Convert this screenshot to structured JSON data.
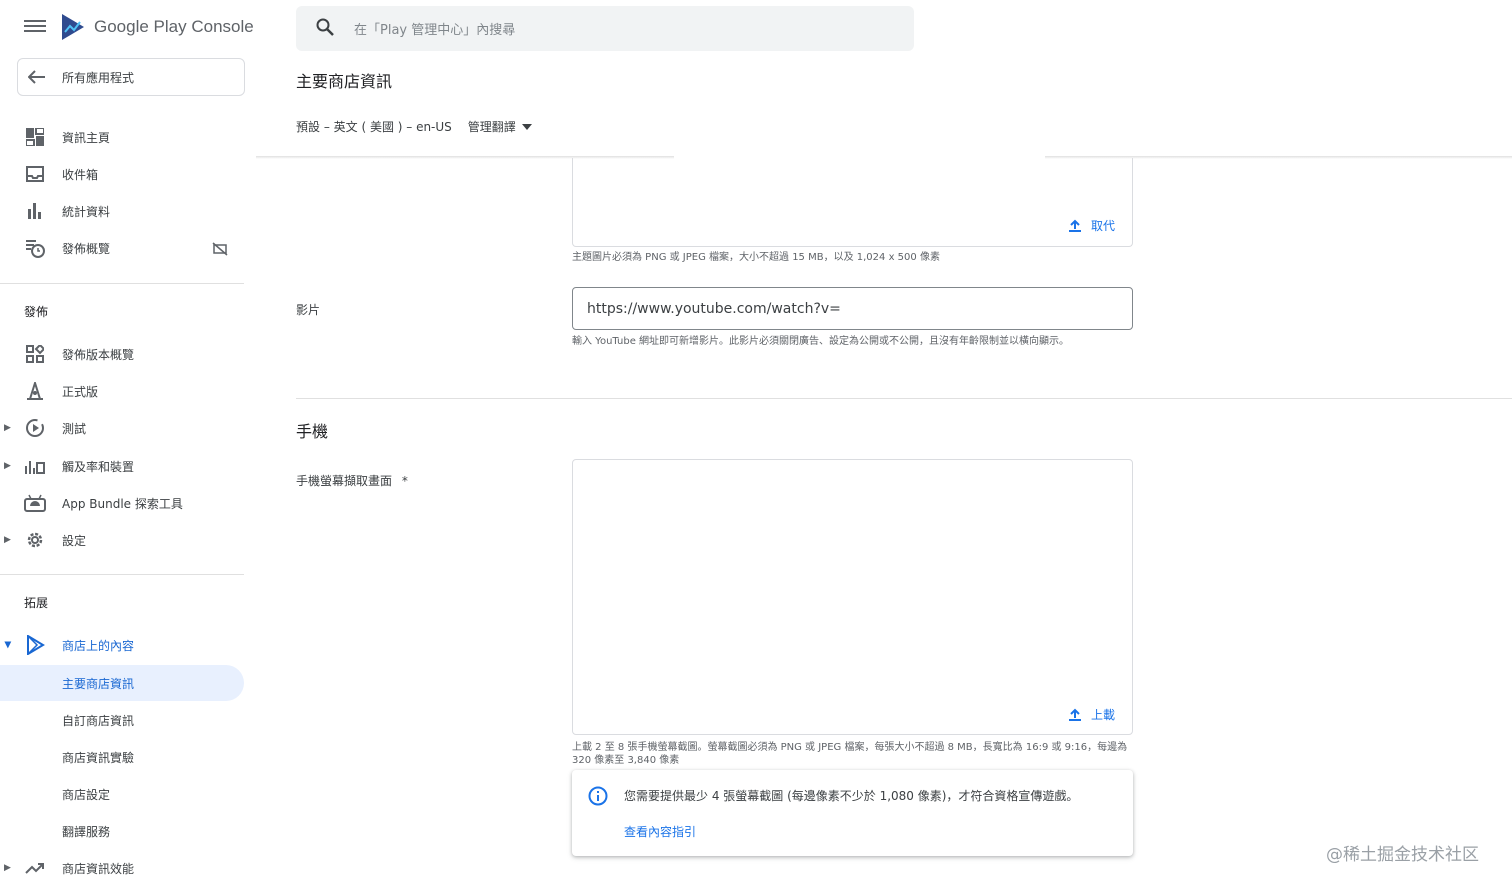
{
  "app": {
    "logo_text": "Google Play Console"
  },
  "search": {
    "placeholder": "在「Play 管理中心」內搜尋"
  },
  "sidebar": {
    "back_label": "所有應用程式",
    "top_items": [
      {
        "label": "資訊主頁",
        "icon": "dashboard-icon"
      },
      {
        "label": "收件箱",
        "icon": "inbox-icon"
      },
      {
        "label": "統計資料",
        "icon": "bar-chart-icon"
      },
      {
        "label": "發佈概覽",
        "icon": "publishing-overview-icon"
      }
    ],
    "release_heading": "發佈",
    "release_items": [
      {
        "label": "發佈版本概覽",
        "icon": "releases-overview-icon"
      },
      {
        "label": "正式版",
        "icon": "production-icon"
      },
      {
        "label": "測試",
        "icon": "testing-icon"
      },
      {
        "label": "觸及率和裝置",
        "icon": "reach-devices-icon"
      },
      {
        "label": "App Bundle 探索工具",
        "icon": "app-bundle-icon"
      },
      {
        "label": "設定",
        "icon": "settings-gear-icon"
      }
    ],
    "grow_heading": "拓展",
    "grow_items": [
      {
        "label": "商店上的內容",
        "icon": "play-store-icon"
      },
      {
        "label": "主要商店資訊"
      },
      {
        "label": "自訂商店資訊"
      },
      {
        "label": "商店資訊實驗"
      },
      {
        "label": "商店設定"
      },
      {
        "label": "翻譯服務"
      },
      {
        "label": "商店資訊效能",
        "icon": "trending-icon"
      }
    ]
  },
  "main": {
    "title": "主要商店資訊",
    "language": "預設 – 英文 ( 美國 ) – en-US",
    "manage_translations": "管理翻譯",
    "feature_graphic": {
      "replace_label": "取代",
      "help": "主題圖片必須為 PNG 或 JPEG 檔案，大小不超過 15 MB，以及 1,024 x 500 像素"
    },
    "video": {
      "label": "影片",
      "value": "https://www.youtube.com/watch?v=",
      "help": "輸入 YouTube 網址即可新增影片。此影片必須關閉廣告、設定為公開或不公開，且沒有年齡限制並以橫向顯示。"
    },
    "phone_section": {
      "title": "手機",
      "screenshots_label": "手機螢幕擷取畫面",
      "required_mark": "*",
      "upload_label": "上載",
      "help": "上載 2 至 8 張手機螢幕截圖。螢幕截圖必須為 PNG 或 JPEG 檔案，每張大小不超過 8 MB，長寬比為 16:9 或 9:16，每邊為 320 像素至 3,840 像素",
      "info_message": "您需要提供最少 4 張螢幕截圖 (每邊像素不少於 1,080 像素)，才符合資格宣傳遊戲。",
      "info_link": "查看內容指引"
    }
  },
  "watermark": "@稀土掘金技术社区",
  "colors": {
    "accent": "#1a73e8",
    "active_bg": "#e8f0fe"
  }
}
